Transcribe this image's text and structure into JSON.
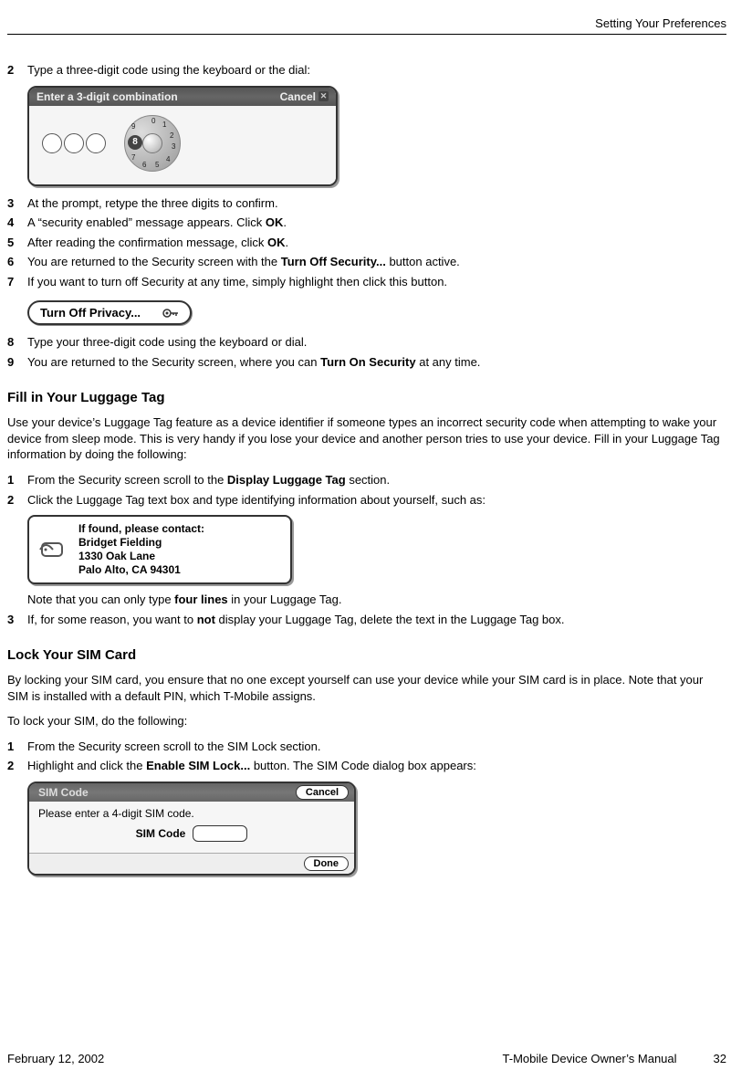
{
  "header": {
    "section": "Setting Your Preferences"
  },
  "stepsA": [
    {
      "n": "2",
      "pre": "Type a three-digit code using the keyboard or the dial:"
    }
  ],
  "combo": {
    "title": "Enter a 3-digit combination",
    "cancel": "Cancel",
    "selected": "8"
  },
  "stepsB": [
    {
      "n": "3",
      "t1": "At the prompt, retype the three digits to confirm."
    },
    {
      "n": "4",
      "t1": "A “security enabled” message appears. Click ",
      "b1": "OK",
      "t2": "."
    },
    {
      "n": "5",
      "t1": "After reading the confirmation message, click ",
      "b1": "OK",
      "t2": "."
    },
    {
      "n": "6",
      "t1": "You are returned to the Security screen with the ",
      "b1": "Turn Off Security...",
      "t2": " button active."
    },
    {
      "n": "7",
      "t1": "If you want to turn off Security at any time, simply highlight then click this button."
    }
  ],
  "privacyBtn": {
    "label": "Turn Off Privacy..."
  },
  "stepsC": [
    {
      "n": "8",
      "t1": "Type your three-digit code using the keyboard or dial."
    },
    {
      "n": "9",
      "t1": "You are returned to the Security screen, where you can ",
      "b1": "Turn On Security",
      "t2": " at any time."
    }
  ],
  "luggage": {
    "heading": "Fill in Your Luggage Tag",
    "intro": "Use your device’s Luggage Tag feature as a device identifier if someone types an incorrect security code when attempting to wake your device from sleep mode. This is very handy if you lose your device and another person tries to use your device. Fill in your Luggage Tag information by doing the following:",
    "steps1": {
      "n": "1",
      "t1": "From the Security screen scroll to the ",
      "b1": "Display Luggage Tag",
      "t2": " section."
    },
    "steps2": {
      "n": "2",
      "t1": "Click the Luggage Tag text box and type identifying information about yourself, such as:"
    },
    "tag": {
      "l1": "If found, please contact:",
      "l2": "Bridget Fielding",
      "l3": "1330 Oak Lane",
      "l4": "Palo Alto, CA 94301"
    },
    "noteA": "Note that you can only type ",
    "noteB": "four lines",
    "noteC": " in your Luggage Tag.",
    "steps3": {
      "n": "3",
      "t1": "If, for some reason, you want to ",
      "b1": "not",
      "t2": " display your Luggage Tag, delete the text in the Luggage Tag box."
    }
  },
  "sim": {
    "heading": "Lock Your SIM Card",
    "intro": "By locking your SIM card, you ensure that no one except yourself can use your device while your SIM card is in place. Note that your SIM is installed with a default PIN, which T-Mobile assigns.",
    "intro2": "To lock your SIM, do the following:",
    "step1": {
      "n": "1",
      "t1": "From the Security screen scroll to the SIM Lock section."
    },
    "step2": {
      "n": "2",
      "t1": "Highlight and click the ",
      "b1": "Enable SIM Lock...",
      "t2": " button. The SIM Code dialog box appears:"
    },
    "dialog": {
      "title": "SIM Code",
      "cancel": "Cancel",
      "prompt": "Please enter a 4-digit SIM code.",
      "label": "SIM Code",
      "done": "Done"
    }
  },
  "footer": {
    "date": "February 12, 2002",
    "manual": "T-Mobile Device Owner’s Manual",
    "page": "32"
  }
}
